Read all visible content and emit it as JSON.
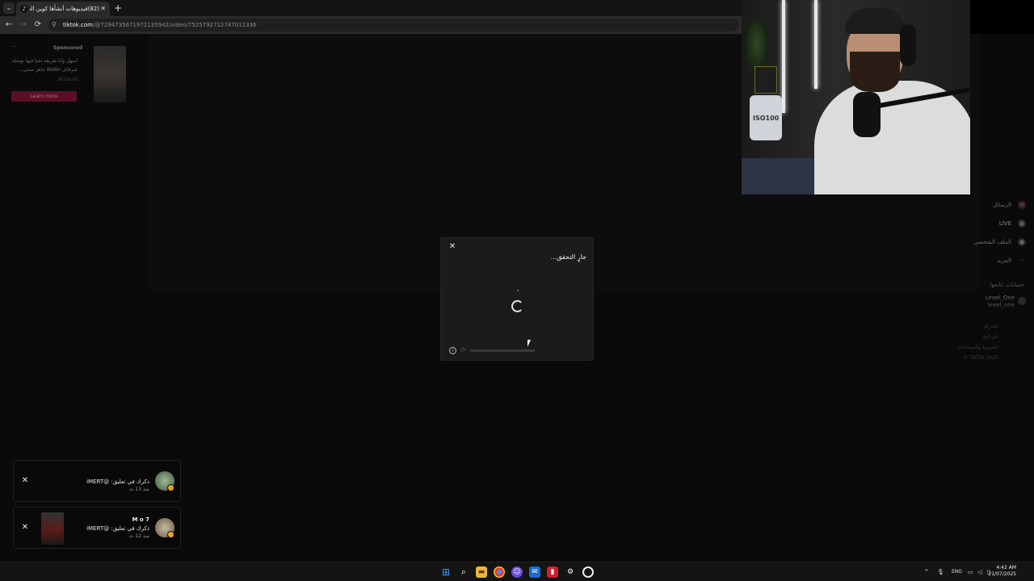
{
  "browser": {
    "tab_title": "(82)فيديوهات أنشأها كوين الحوت",
    "tab_close": "✕",
    "new_tab": "+",
    "tab_menu": "⌄",
    "nav_back": "←",
    "nav_forward": "→",
    "nav_reload": "⟳",
    "site_icon": "⚲",
    "url_host": "tiktok.com",
    "url_path": "/@7294735671972135942/video/7525792712747011336"
  },
  "ad": {
    "dots": "···",
    "sponsored": "Sponsored",
    "line1": "أسهل وأنا طريقة تجيا فيها بوصلة",
    "line2": "شرقاتل WeBo جاهز صحي...",
    "line3": "Account",
    "learn_more": "Learn more"
  },
  "sidebar": {
    "messages": "الرسائل",
    "messages_badge": "31",
    "live": "LIVE",
    "profile": "الملف الشخصي",
    "more": "المزيد",
    "following_header": "حسابات تتابعها",
    "account_name": "Level_One",
    "account_handle": "level_one",
    "footer1": "الشركة",
    "footer2": "البرنامج",
    "footer3": "الشروط والسياسات",
    "footer4": "TikTok 2025 ©"
  },
  "modal": {
    "close": "✕",
    "title": "جارٍ التحقق...",
    "info_icon": "i",
    "refresh_icon": "⟳"
  },
  "notifications": [
    {
      "name": "",
      "text": "ذكرك في تعليق: @iMERT",
      "time": "منذ 13 ث",
      "close": "✕"
    },
    {
      "name": "M o 7",
      "text": "ذكرك في تعليق: @iMERT",
      "time": "منذ 12 ث",
      "close": "✕"
    }
  ],
  "taskbar": {
    "lang": "ENG",
    "time": "4:42 AM",
    "date": "21/07/2025",
    "chevron": "^"
  },
  "colors": {
    "ad_button": "#5b0f24",
    "badge": "#f0a020"
  }
}
